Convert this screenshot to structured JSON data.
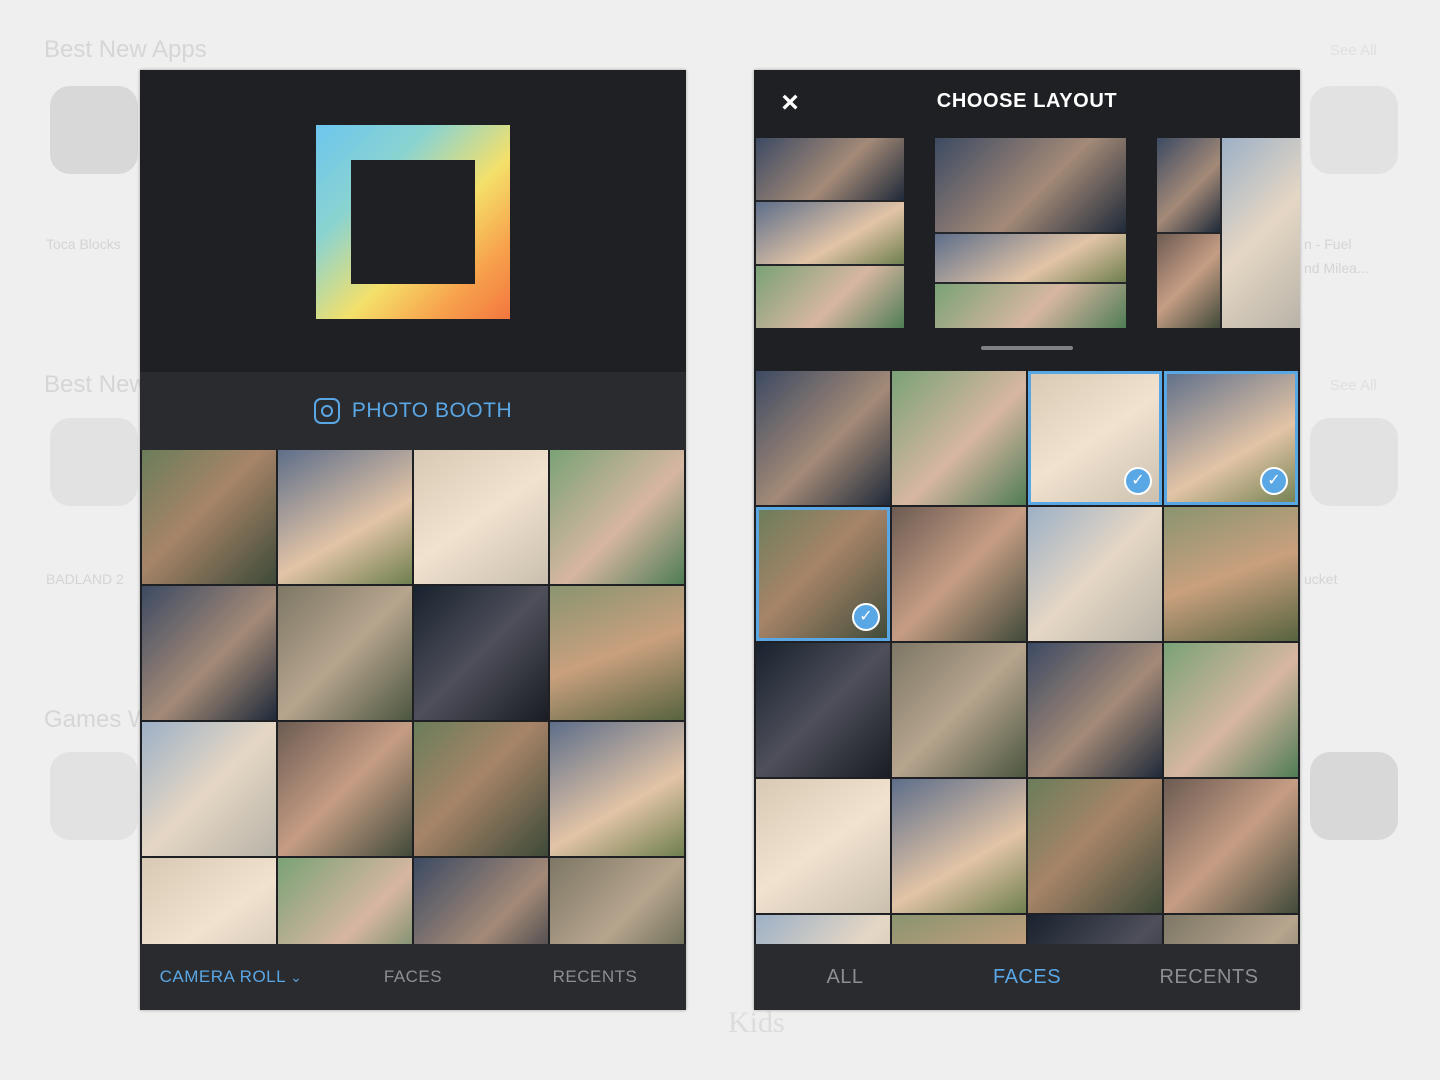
{
  "background": {
    "headings": [
      "Best New Apps",
      "Best New",
      "Games W"
    ],
    "captions": [
      "Toca Blocks",
      "BADLAND 2",
      "n - Fuel",
      "nd Milea...",
      "ucket"
    ],
    "see_all": "See All",
    "kids": "Kids"
  },
  "left_phone": {
    "booth_label": "PHOTO BOOTH",
    "tabs": [
      {
        "label": "CAMERA ROLL",
        "active": true
      },
      {
        "label": "FACES",
        "active": false
      },
      {
        "label": "RECENTS",
        "active": false
      }
    ],
    "photos": [
      "bulldog",
      "coastal-rocks",
      "beach-sitting",
      "sunset-silhouettes",
      "balloons",
      "selfie-girl",
      "selfie-pair",
      "palm-sunset",
      "white-house",
      "cupcakes",
      "sunflowers",
      "bike-leaves",
      "coffee-cup",
      "red-shoes",
      "puppy-1",
      "puppy-2"
    ]
  },
  "right_phone": {
    "title": "CHOOSE LAYOUT",
    "close_icon": "×",
    "tabs": [
      {
        "label": "ALL",
        "active": false
      },
      {
        "label": "FACES",
        "active": true
      },
      {
        "label": "RECENTS",
        "active": false
      }
    ],
    "layouts": [
      "three-stack",
      "three-stack-wide",
      "two-column"
    ],
    "photos": [
      {
        "name": "selfie-pair",
        "selected": false
      },
      {
        "name": "selfie-girl",
        "selected": false
      },
      {
        "name": "friends-group",
        "selected": true
      },
      {
        "name": "lying-grass",
        "selected": true
      },
      {
        "name": "park-friends",
        "selected": true
      },
      {
        "name": "beach-blonde-1",
        "selected": false
      },
      {
        "name": "beach-blonde-2",
        "selected": false
      },
      {
        "name": "rock-sitting",
        "selected": false
      },
      {
        "name": "white-dress",
        "selected": false
      },
      {
        "name": "bearded-selfie",
        "selected": false
      },
      {
        "name": "group-selfie",
        "selected": false
      },
      {
        "name": "glasses-guy",
        "selected": false
      },
      {
        "name": "girl-phone",
        "selected": false
      },
      {
        "name": "laughing-girl",
        "selected": false
      },
      {
        "name": "night-group",
        "selected": false
      },
      {
        "name": "puppy-hug",
        "selected": false
      },
      {
        "name": "partial-1",
        "selected": false
      },
      {
        "name": "partial-2",
        "selected": false
      },
      {
        "name": "partial-3",
        "selected": false
      },
      {
        "name": "partial-4",
        "selected": false
      }
    ],
    "check_glyph": "✓"
  }
}
